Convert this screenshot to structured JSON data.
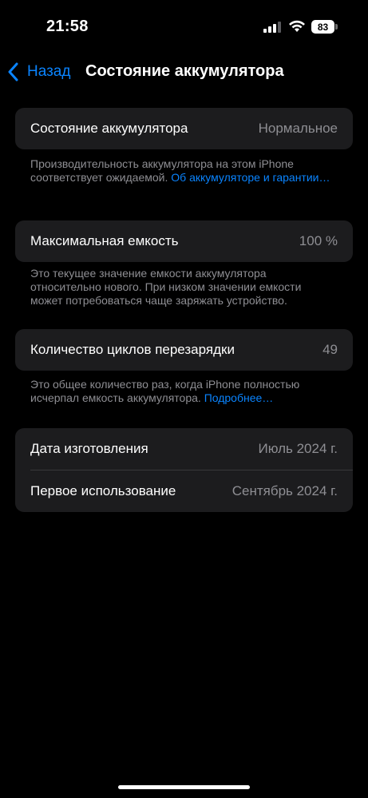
{
  "status_bar": {
    "time": "21:58",
    "battery_level": "83",
    "signal_icon": "cellular-signal-icon",
    "wifi_icon": "wifi-icon"
  },
  "nav": {
    "back_label": "Назад",
    "title": "Состояние аккумулятора"
  },
  "battery_condition": {
    "label": "Состояние аккумулятора",
    "value": "Нормальное",
    "footnote_text": "Производительность аккумулятора на этом iPhone соответствует ожидаемой. ",
    "footnote_link": "Об аккумуляторе и гарантии…"
  },
  "max_capacity": {
    "label": "Максимальная емкость",
    "value": "100 %",
    "footnote_text": "Это текущее значение емкости аккумулятора относительно нового. При низком значении емкости может потребоваться чаще заряжать устройство."
  },
  "cycle_count": {
    "label": "Количество циклов перезарядки",
    "value": "49",
    "footnote_text": "Это общее количество раз, когда iPhone полностью исчерпал емкость аккумулятора. ",
    "footnote_link": "Подробнее…"
  },
  "dates": {
    "manufacture_label": "Дата изготовления",
    "manufacture_value": "Июль 2024 г.",
    "first_use_label": "Первое использование",
    "first_use_value": "Сентябрь 2024 г."
  },
  "colors": {
    "accent": "#0a84ff",
    "background": "#000000",
    "card": "#1c1c1e",
    "secondary_text": "#8e8e93"
  }
}
